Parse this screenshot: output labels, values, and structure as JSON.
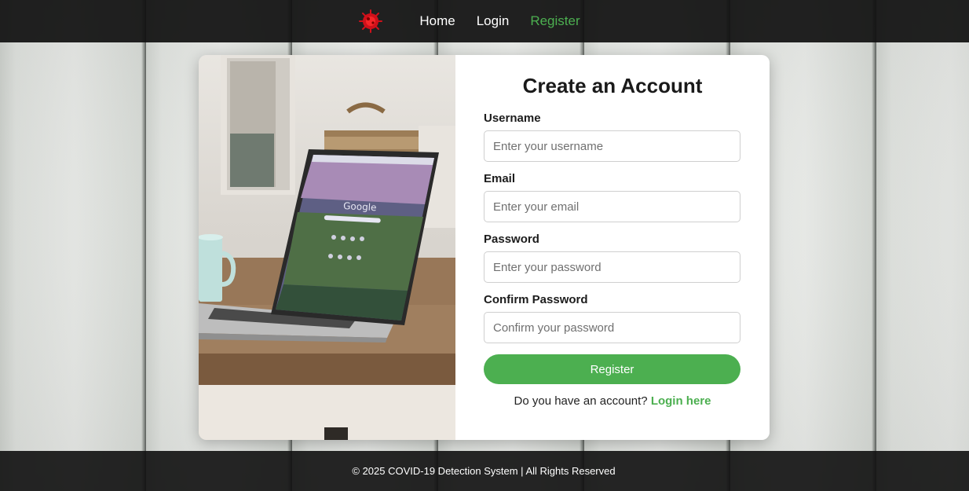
{
  "colors": {
    "accent": "#4caf50",
    "navbar_bg": "#0f0f0f",
    "logo_red": "#d0101a"
  },
  "nav": {
    "logo_icon": "virus-icon",
    "links": [
      {
        "label": "Home"
      },
      {
        "label": "Login"
      },
      {
        "label": "Register"
      }
    ]
  },
  "form": {
    "title": "Create an Account",
    "fields": [
      {
        "label": "Username",
        "placeholder": "Enter your username"
      },
      {
        "label": "Email",
        "placeholder": "Enter your email"
      },
      {
        "label": "Password",
        "placeholder": "Enter your password"
      },
      {
        "label": "Confirm Password",
        "placeholder": "Confirm your password"
      }
    ],
    "submit_label": "Register",
    "account_prompt": "Do you have an account?",
    "login_link": "Login here"
  },
  "photo": {
    "screen_brand": "Google"
  },
  "footer": {
    "text": "© 2025 COVID-19 Detection System | All Rights Reserved"
  }
}
